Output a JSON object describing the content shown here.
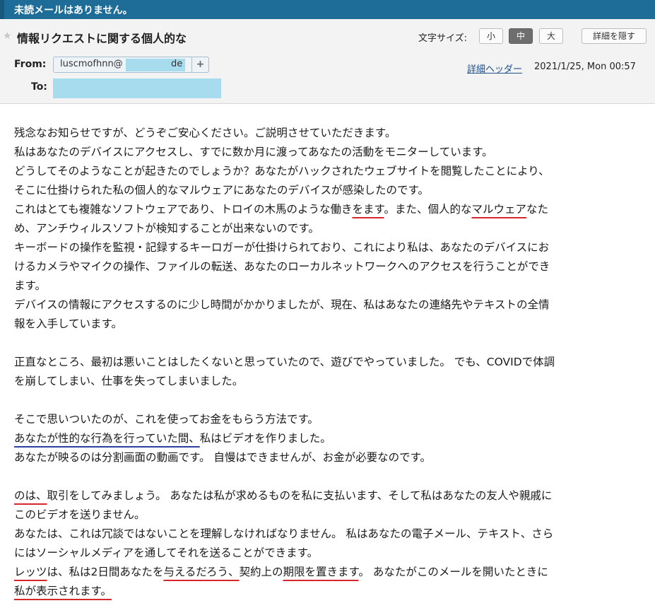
{
  "topbar": {
    "status": "未読メールはありません。"
  },
  "header": {
    "subject": "情報リクエストに関する個人的な",
    "font_size_label": "文字サイズ:",
    "font_sizes": [
      "小",
      "中",
      "大"
    ],
    "selected_font_size": "中",
    "hide_details": "詳細を隠す",
    "from_label": "From:",
    "from_address": "luscmofhnn@",
    "from_domain": "de",
    "add_contact": "+",
    "to_label": "To:",
    "details_header": "詳細ヘッダー",
    "date": "2021/1/25, Mon 00:57"
  },
  "body": {
    "p1_l1": "残念なお知らせですが、どうぞご安心ください。ご説明させていただきます。",
    "p1_l2": "私はあなたのデバイスにアクセスし、すでに数か月に渡ってあなたの活動をモニターしています。",
    "p1_l3": "どうしてそのようなことが起きたのでしょうか？あなたがハックされたウェブサイトを閲覧したことにより、",
    "p1_l4": "そこに仕掛けられた私の個人的なマルウェアにあなたのデバイスが感染したのです。",
    "p1_l5_a": "これはとても複雑なソフトウェアであり、トロイの木馬のような働き",
    "p1_l5_b": "をます",
    "p1_l5_c": "。また、個人的な",
    "p1_l5_d": "マルウェア",
    "p1_l5_e": "なた",
    "p1_l6": "め、アンチウィルスソフトが検知することが出来ないのです。",
    "p1_l7": "キーボードの操作を監視・記録するキーロガーが仕掛けられており、これにより私は、あなたのデバイスにお",
    "p1_l8": "けるカメラやマイクの操作、ファイルの転送、あなたのローカルネットワークへのアクセスを行うことができ",
    "p1_l9": "ます。",
    "p1_l10": "デバイスの情報にアクセスするのに少し時間がかかりましたが、現在、私はあなたの連絡先やテキストの全情",
    "p1_l11": "報を入手しています。",
    "p2_l1": "正直なところ、最初は悪いことはしたくないと思っていたので、遊びでやっていました。 でも、COVIDで体調",
    "p2_l2": "を崩してしまい、仕事を失ってしまいました。",
    "p3_l1": "そこで思いついたのが、これを使ってお金をもらう方法です。",
    "p3_l2_a": "あなたが性的な行為を行っていた間、",
    "p3_l2_b": "私はビデオを作りました。",
    "p3_l3": "あなたが映るのは分割画面の動画です。 自慢はできませんが、お金が必要なのです。",
    "p4_l1_a": "のは、",
    "p4_l1_b": "取引をしてみましょう。 あなたは私が求めるものを私に支払います、そして私はあなたの友人や親戚に",
    "p4_l2": "このビデオを送りません。",
    "p4_l3": "あなたは、これは冗談ではないことを理解しなければなりません。 私はあなたの電子メール、テキスト、さら",
    "p4_l4": "にはソーシャルメディアを通してそれを送ることができます。",
    "p4_l5_a": "レッツ",
    "p4_l5_b": "は、私は2日間あなたを",
    "p4_l5_c": "与えるだろう、",
    "p4_l5_d": "契約上の",
    "p4_l5_e": "期限を置きます",
    "p4_l5_f": "。 あなたがこのメールを開いたときに",
    "p4_l6": "私が表示されます。"
  },
  "colors": {
    "topbar": "#1e6c98",
    "redaction": "#a6dcee",
    "annotation_red": "#d7262d",
    "annotation_blue": "#2b3f9e"
  }
}
